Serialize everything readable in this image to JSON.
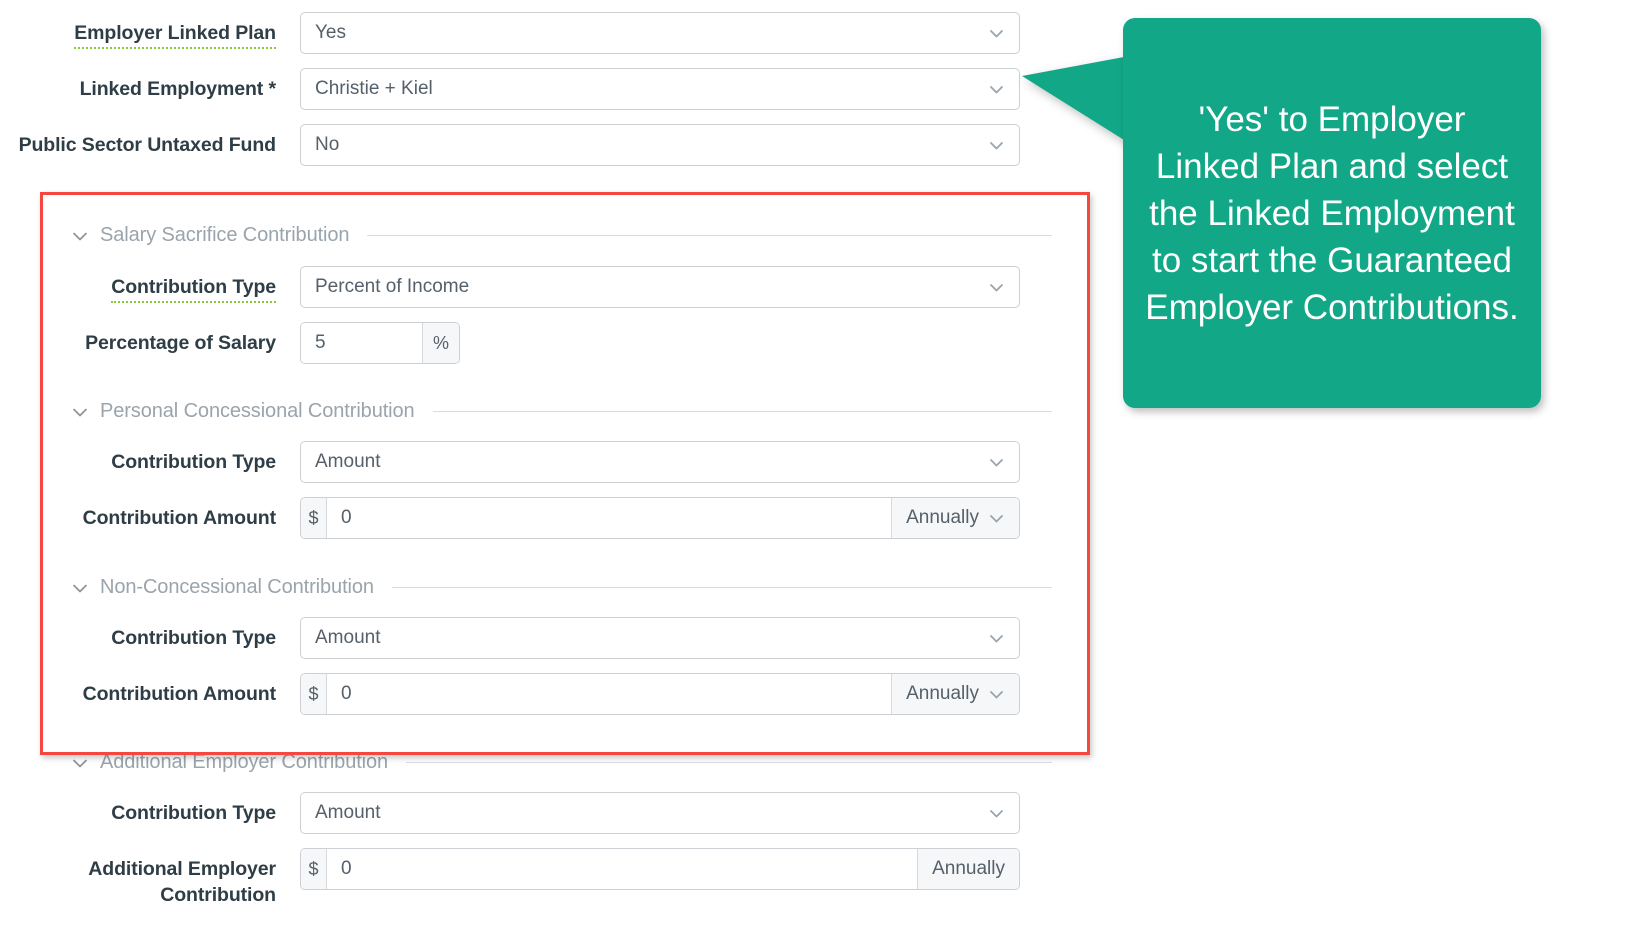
{
  "form": {
    "top_fields": [
      {
        "label": "Employer Linked Plan",
        "has_help_underline": true,
        "control": "select",
        "value": "Yes",
        "name": "employer-linked-plan"
      },
      {
        "label": "Linked Employment *",
        "has_help_underline": false,
        "control": "select",
        "value": "Christie + Kiel",
        "name": "linked-employment"
      },
      {
        "label": "Public Sector Untaxed Fund",
        "has_help_underline": false,
        "control": "select",
        "value": "No",
        "name": "public-sector-untaxed-fund"
      }
    ],
    "sections": [
      {
        "title": "Salary Sacrifice Contribution",
        "name": "salary-sacrifice-contribution",
        "rows": [
          {
            "label": "Contribution Type",
            "has_help_underline": true,
            "control": "select",
            "value": "Percent of Income",
            "name": "salary-sacrifice-contribution-type"
          },
          {
            "label": "Percentage of Salary",
            "has_help_underline": false,
            "control": "percent",
            "value": "5",
            "suffix": "%",
            "name": "salary-sacrifice-percentage-of-salary"
          }
        ]
      },
      {
        "title": "Personal Concessional Contribution",
        "name": "personal-concessional-contribution",
        "rows": [
          {
            "label": "Contribution Type",
            "has_help_underline": false,
            "control": "select",
            "value": "Amount",
            "name": "personal-concessional-contribution-type"
          },
          {
            "label": "Contribution Amount",
            "has_help_underline": false,
            "control": "money",
            "prefix": "$",
            "value": "0",
            "frequency": "Annually",
            "frequency_chevron": true,
            "name": "personal-concessional-contribution-amount"
          }
        ]
      },
      {
        "title": "Non-Concessional Contribution",
        "name": "non-concessional-contribution",
        "rows": [
          {
            "label": "Contribution Type",
            "has_help_underline": false,
            "control": "select",
            "value": "Amount",
            "name": "non-concessional-contribution-type"
          },
          {
            "label": "Contribution Amount",
            "has_help_underline": false,
            "control": "money",
            "prefix": "$",
            "value": "0",
            "frequency": "Annually",
            "frequency_chevron": true,
            "name": "non-concessional-contribution-amount"
          }
        ]
      },
      {
        "title": "Additional Employer Contribution",
        "name": "additional-employer-contribution",
        "rows": [
          {
            "label": "Contribution Type",
            "has_help_underline": false,
            "control": "select",
            "value": "Amount",
            "name": "additional-employer-contribution-type"
          },
          {
            "label": "Additional Employer Contribution",
            "has_help_underline": false,
            "control": "money",
            "prefix": "$",
            "value": "0",
            "frequency": "Annually",
            "frequency_chevron": false,
            "name": "additional-employer-contribution-amount"
          }
        ]
      }
    ]
  },
  "callout": {
    "text": "'Yes' to Employer Linked Plan and select the Linked Employment to start the Guaranteed Employer Contributions.",
    "background_color": "#12a887",
    "text_color": "#ffffff"
  },
  "highlight": {
    "color": "#f4473f"
  },
  "icons": {
    "chevron_down": "chevron-down-icon",
    "section_collapse": "chevron-down-icon"
  }
}
